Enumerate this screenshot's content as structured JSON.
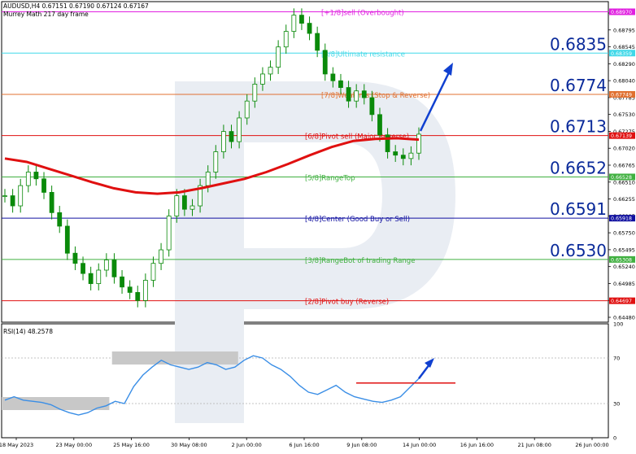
{
  "header": {
    "symbol_line": "AUDUSD,H4  0.67151 0.67190 0.67124 0.67167",
    "indicator_name": "Murrey Math 217 day frame",
    "rsi_label": "RSI(14) 48.2578"
  },
  "colors": {
    "candle": "#0a8a0a",
    "ma": "#e01010",
    "arrow": "#1040d0",
    "watermark": "#e9edf3",
    "zone": "#c8c8c8"
  },
  "chart_data": [
    {
      "type": "line",
      "title": "",
      "ylim": [
        0.6438,
        0.6912
      ],
      "y_ticks": [
        "0.69055",
        "0.68795",
        "0.68545",
        "0.68290",
        "0.68040",
        "0.67785",
        "0.67530",
        "0.67275",
        "0.67020",
        "0.66765",
        "0.66510",
        "0.66255",
        "0.66005",
        "0.65750",
        "0.65495",
        "0.65240",
        "0.64985",
        "0.64730",
        "0.64480"
      ],
      "x_ticks": [
        "18 May 2023",
        "23 May 00:00",
        "25 May 16:00",
        "30 May 08:00",
        "2 Jun 00:00",
        "6 Jun 16:00",
        "9 Jun 08:00",
        "14 Jun 00:00",
        "16 Jun 16:00",
        "21 Jun 08:00",
        "26 Jun 00:00"
      ],
      "levels": [
        {
          "name": "[+1/8]sell (Overbought)",
          "value": 0.6897,
          "tag": "0.68970",
          "color": "#e020e0"
        },
        {
          "name": "[8/8]Ultimate resistance",
          "value": 0.68359,
          "tag": "0.68359",
          "color": "#40d8e8"
        },
        {
          "name": "[7/8]Weak res (Stop & Reverse)",
          "value": 0.67749,
          "tag": "0.67749",
          "color": "#e07030"
        },
        {
          "name": "[6/8]Pivot sell (Major Reverse)",
          "value": 0.67139,
          "tag": "0.67139",
          "color": "#e01010"
        },
        {
          "name": "[5/8]RangeTop",
          "value": 0.66528,
          "tag": "0.66528",
          "color": "#40b040"
        },
        {
          "name": "[4/8]Center (Good Buy or Sell)",
          "value": 0.65918,
          "tag": "0.65918",
          "color": "#1010a0"
        },
        {
          "name": "[3/8]RangeBot of trading Range",
          "value": 0.65308,
          "tag": "0.65308",
          "color": "#40b040"
        },
        {
          "name": "[2/8]Pivot buy (Reverse)",
          "value": 0.64697,
          "tag": "0.64697",
          "color": "#e01010"
        }
      ],
      "big_labels": [
        "0.6835",
        "0.6774",
        "0.6713",
        "0.6652",
        "0.6591",
        "0.6530"
      ],
      "price_series": [
        0.6625,
        0.661,
        0.664,
        0.666,
        0.665,
        0.663,
        0.66,
        0.658,
        0.654,
        0.6525,
        0.651,
        0.6495,
        0.6515,
        0.653,
        0.6505,
        0.649,
        0.6482,
        0.647,
        0.65,
        0.6525,
        0.6545,
        0.6595,
        0.6625,
        0.6605,
        0.661,
        0.664,
        0.666,
        0.669,
        0.672,
        0.6705,
        0.674,
        0.6765,
        0.679,
        0.6805,
        0.6815,
        0.6845,
        0.6868,
        0.6892,
        0.688,
        0.6865,
        0.684,
        0.6805,
        0.6795,
        0.6785,
        0.6765,
        0.678,
        0.677,
        0.6745,
        0.6715,
        0.669,
        0.6685,
        0.668,
        0.6688,
        0.6716
      ],
      "ma_series": [
        0.668,
        0.6675,
        0.6665,
        0.6655,
        0.6645,
        0.6636,
        0.663,
        0.6628,
        0.663,
        0.6636,
        0.6643,
        0.665,
        0.666,
        0.6672,
        0.6685,
        0.6697,
        0.6706,
        0.6709,
        0.671,
        0.6708
      ]
    },
    {
      "type": "line",
      "title": "RSI(14) 48.2578",
      "ylim": [
        0,
        100
      ],
      "y_ticks": [
        "100",
        "70",
        "30",
        "0"
      ],
      "zones": [
        {
          "from_index": 0,
          "to_index": 11,
          "value": 30
        },
        {
          "from_index": 12,
          "to_index": 25,
          "value": 70
        }
      ],
      "values": [
        33,
        36,
        33,
        32,
        31,
        29,
        25,
        22,
        20,
        22,
        26,
        28,
        32,
        30,
        45,
        55,
        62,
        68,
        64,
        62,
        60,
        62,
        66,
        64,
        60,
        62,
        68,
        72,
        70,
        64,
        60,
        54,
        46,
        40,
        38,
        42,
        46,
        40,
        36,
        34,
        32,
        31,
        33,
        36,
        44,
        52
      ],
      "trend_line_value": 48
    }
  ]
}
